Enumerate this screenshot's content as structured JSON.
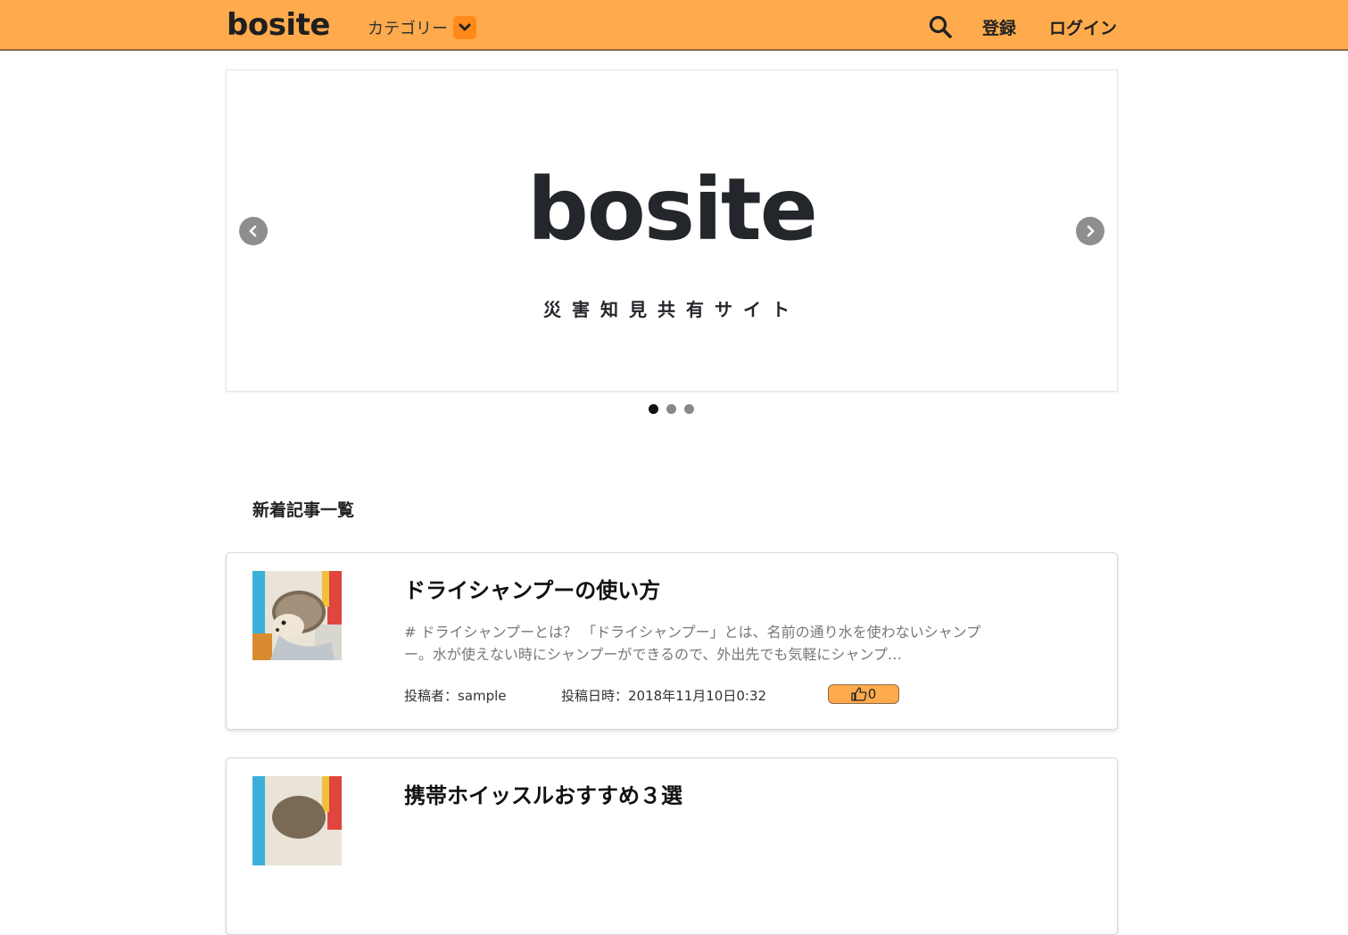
{
  "header": {
    "logo": "bosite",
    "category_label": "カテゴリー",
    "register_label": "登録",
    "login_label": "ログイン"
  },
  "carousel": {
    "logo_text": "bosite",
    "tagline": "災害知見共有サイト",
    "slide_count": 3,
    "active_slide": 1
  },
  "section_title": "新着記事一覧",
  "articles": [
    {
      "title": "ドライシャンプーの使い方",
      "excerpt": "# ドライシャンプーとは？ 「ドライシャンプー」とは、名前の通り水を使わないシャンプー。水が使えない時にシャンプーができるので、外出先でも気軽にシャンプ…",
      "author": "投稿者：sample",
      "date": "投稿日時：2018年11月10日0:32",
      "likes": "0"
    },
    {
      "title": "携帯ホイッスルおすすめ３選"
    }
  ],
  "colors": {
    "accent": "#ffab4d",
    "accent_dark": "#ff8a1a",
    "text": "#222222"
  }
}
